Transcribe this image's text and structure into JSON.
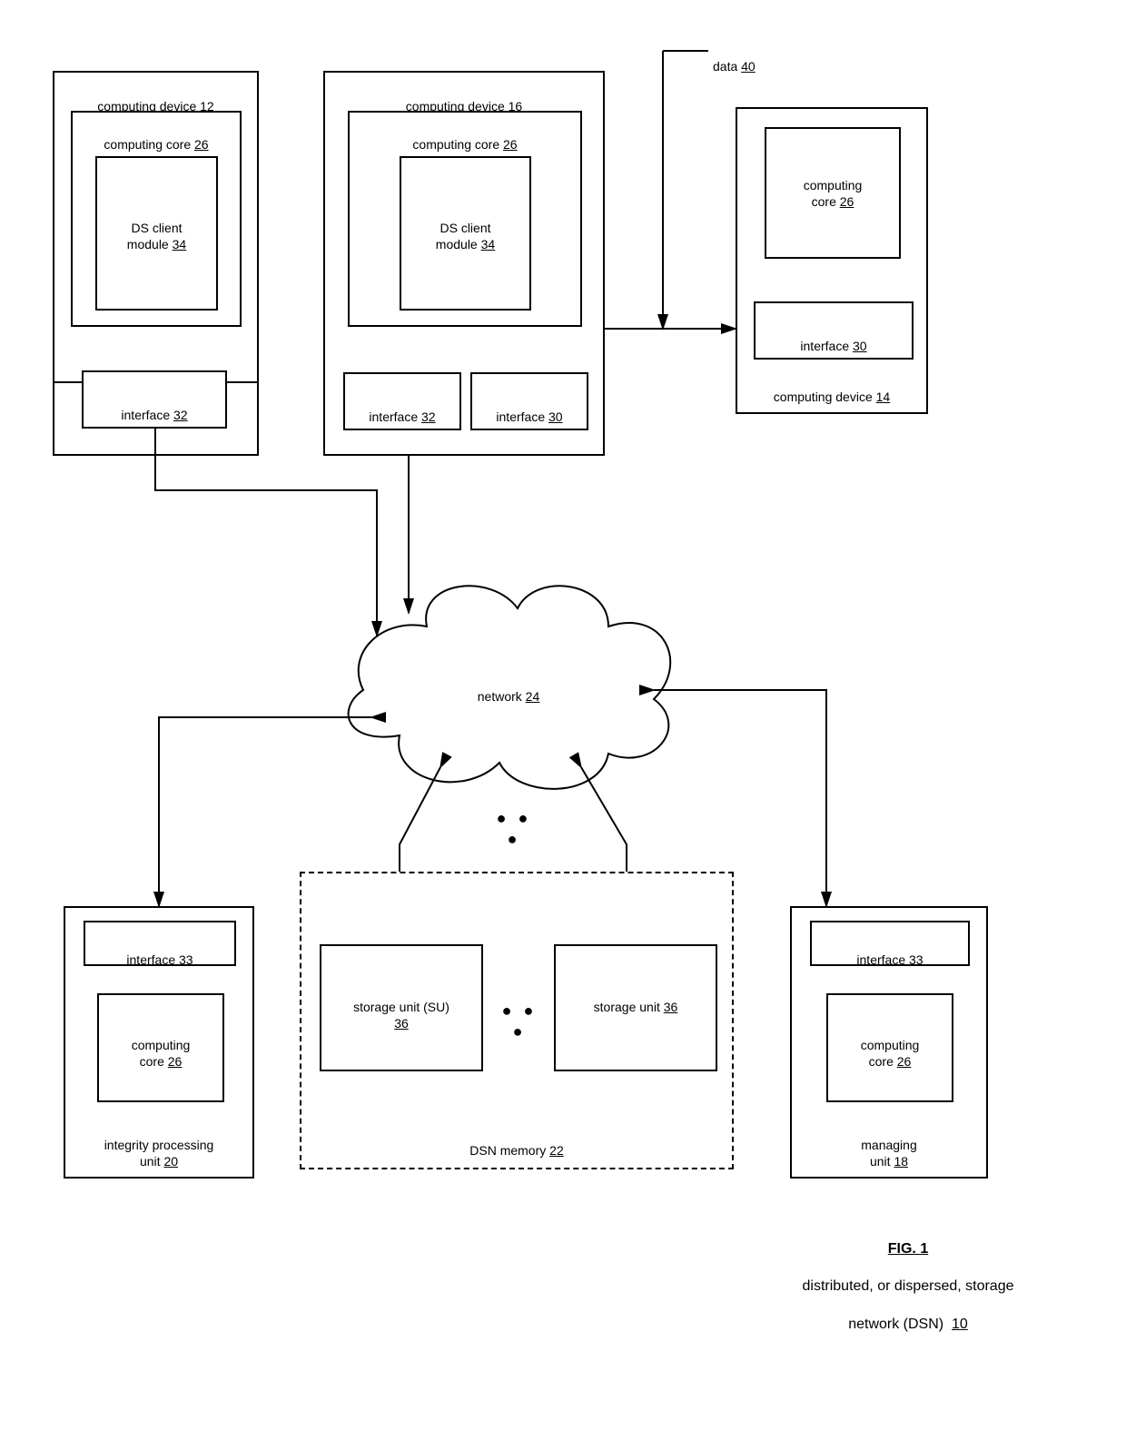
{
  "figure": {
    "title": "FIG. 1",
    "caption_line1": "distributed, or dispersed, storage",
    "caption_line2": "network (DSN)",
    "caption_ref": "10"
  },
  "network": {
    "label": "network",
    "ref": "24"
  },
  "data": {
    "label": "data",
    "ref": "40"
  },
  "cd12": {
    "title": "computing device",
    "ref": "12",
    "core": "computing core",
    "coreref": "26",
    "ds": "DS client",
    "ds2": "module",
    "dsref": "34",
    "iface": "interface",
    "ifref": "32"
  },
  "cd16": {
    "title": "computing device",
    "ref": "16",
    "core": "computing core",
    "coreref": "26",
    "ds": "DS client",
    "ds2": "module",
    "dsref": "34",
    "ifaceA": "interface",
    "ifrefA": "32",
    "ifaceB": "interface",
    "ifrefB": "30"
  },
  "cd14": {
    "title": "computing device",
    "ref": "14",
    "core": "computing",
    "core2": "core",
    "coreref": "26",
    "iface": "interface",
    "ifref": "30"
  },
  "ipu": {
    "title_l1": "integrity processing",
    "title_l2": "unit",
    "ref": "20",
    "iface": "interface",
    "ifref": "33",
    "core": "computing",
    "core2": "core",
    "coreref": "26"
  },
  "mgr": {
    "title": "managing",
    "title2": "unit",
    "ref": "18",
    "iface": "interface",
    "ifref": "33",
    "core": "computing",
    "core2": "core",
    "coreref": "26"
  },
  "dsnmem": {
    "title": "DSN memory",
    "ref": "22",
    "su1_l1": "storage unit (SU)",
    "su1_ref": "36",
    "su2_l1": "storage unit",
    "su2_ref": "36"
  },
  "dots": "● ● ●"
}
